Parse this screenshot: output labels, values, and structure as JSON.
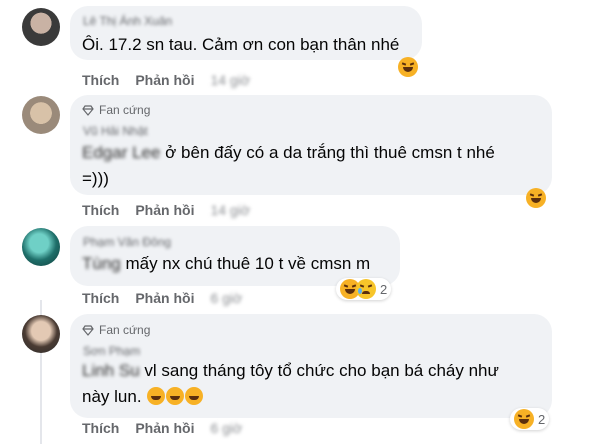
{
  "comments": [
    {
      "name": "Lê Thị Ánh Xuân",
      "text": "Ôi. 17.2 sn tau. Cảm ơn con bạn thân nhé",
      "like": "Thích",
      "reply": "Phản hồi",
      "time": "14 giờ",
      "reaction_count": ""
    },
    {
      "badge": "Fan cứng",
      "name": "Vũ Hải Nhật",
      "tag": "Edgar Lee",
      "line1": " ở bên đấy có a da trắng thì thuê cmsn t nhé",
      "line2": "=)))",
      "like": "Thích",
      "reply": "Phản hồi",
      "time": "14 giờ",
      "reaction_count": ""
    },
    {
      "name": "Phạm Văn Đông",
      "tag": "Tùng",
      "text": " mấy nx chú thuê 10 t về cmsn m",
      "like": "Thích",
      "reply": "Phản hồi",
      "time": "6 giờ",
      "reaction_count": "2"
    },
    {
      "badge": "Fan cứng",
      "name": "Sơn Phạm",
      "tag": "Linh Su",
      "line1": " vl sang tháng tôy tổ chức cho bạn bá cháy như",
      "line2": "này lun.",
      "like": "Thích",
      "reply": "Phản hồi",
      "time": "6 giờ",
      "reaction_count": "2"
    }
  ],
  "icons": {
    "badge": "diamond-icon",
    "reaction_haha": "haha-emoji-icon",
    "reaction_sad": "sad-emoji-icon"
  },
  "colors": {
    "bubble": "#f0f2f5",
    "secondary_text": "#65676b"
  }
}
